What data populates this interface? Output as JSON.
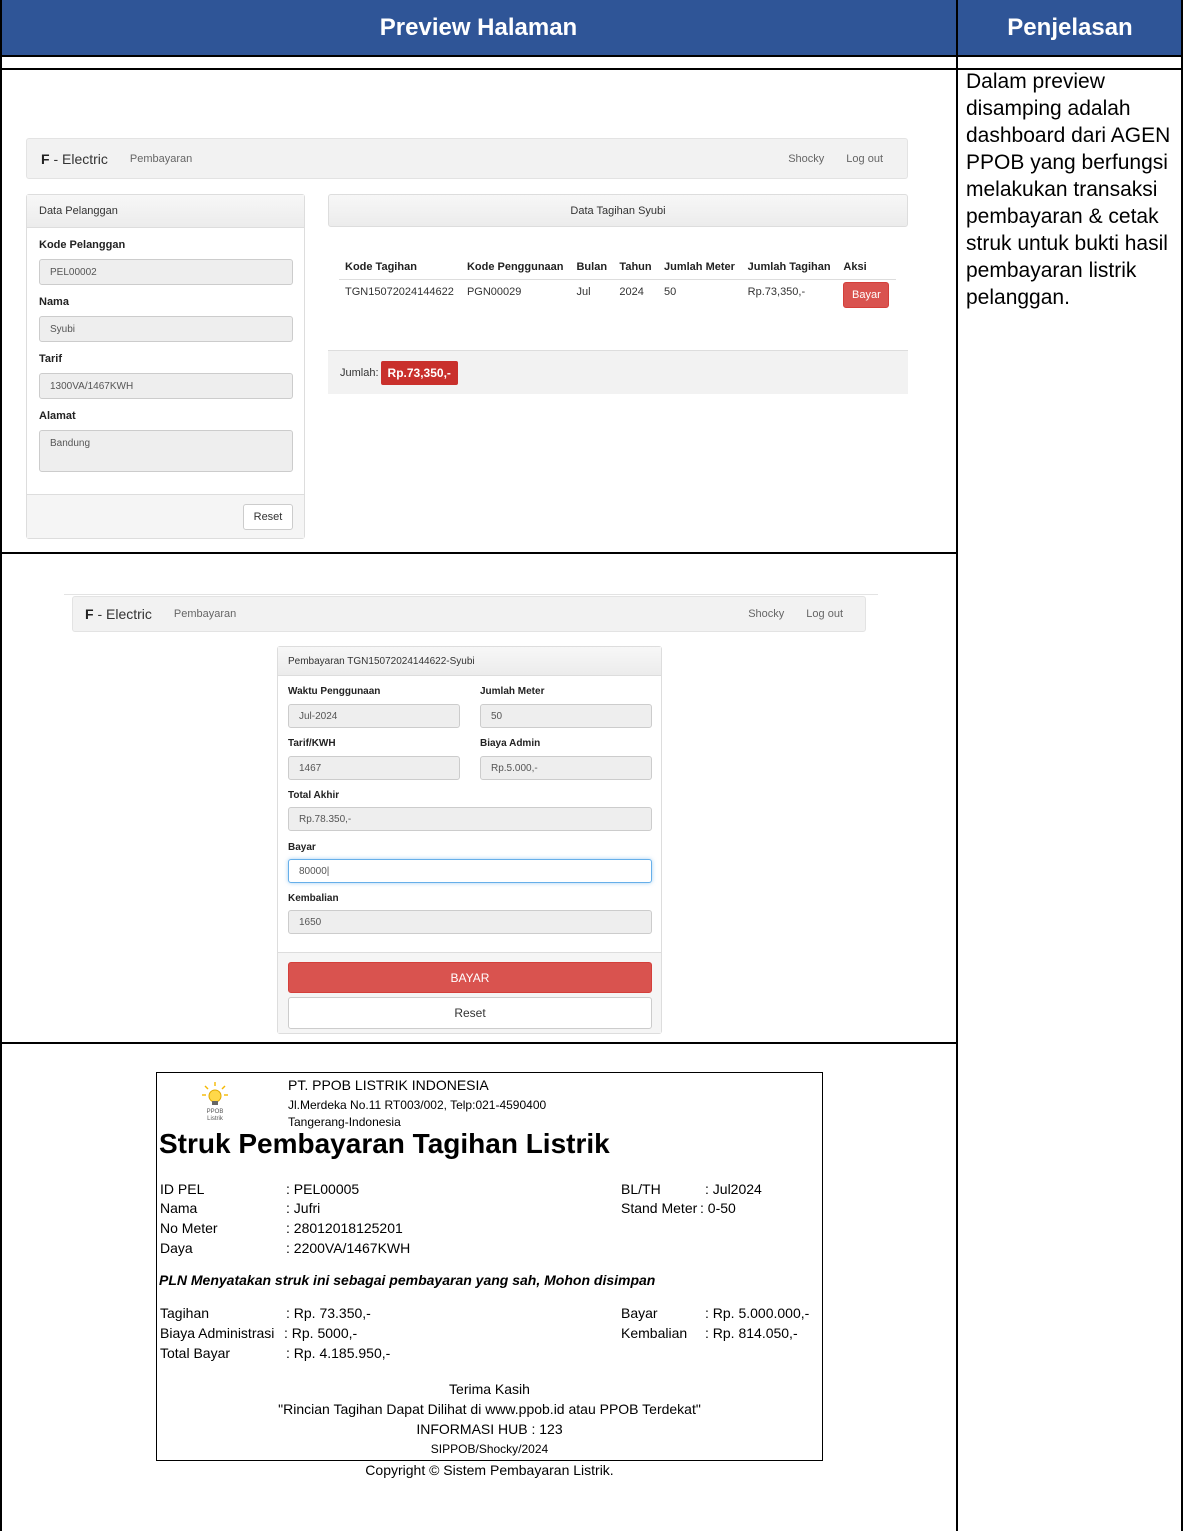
{
  "headers": {
    "preview": "Preview Halaman",
    "explanation": "Penjelasan"
  },
  "explanation": "Dalam preview disamping adalah dashboard dari AGEN PPOB yang berfungsi melakukan transaksi pembayaran & cetak struk untuk bukti hasil pembayaran listrik pelanggan.",
  "dashboard": {
    "brand_bold": "F",
    "brand_rest": " - Electric",
    "nav_link": "Pembayaran",
    "user": "Shocky",
    "logout": "Log out",
    "customer_panel": {
      "title": "Data Pelanggan",
      "fields": [
        {
          "label": "Kode Pelanggan",
          "value": "PEL00002"
        },
        {
          "label": "Nama",
          "value": "Syubi"
        },
        {
          "label": "Tarif",
          "value": "1300VA/1467KWH"
        },
        {
          "label": "Alamat",
          "value": "Bandung"
        }
      ],
      "reset": "Reset"
    },
    "bill_panel": {
      "title": "Data Tagihan Syubi",
      "columns": [
        "Kode Tagihan",
        "Kode Penggunaan",
        "Bulan",
        "Tahun",
        "Jumlah Meter",
        "Jumlah Tagihan",
        "Aksi"
      ],
      "row": {
        "kode_tagihan": "TGN15072024144622",
        "kode_penggunaan": "PGN00029",
        "bulan": "Jul",
        "tahun": "2024",
        "jumlah_meter": "50",
        "jumlah_tagihan": "Rp.73,350,-",
        "aksi": "Bayar"
      },
      "total_label": "Jumlah:",
      "total_value": "Rp.73,350,-"
    }
  },
  "payment": {
    "brand_bold": "F",
    "brand_rest": " - Electric",
    "nav_link": "Pembayaran",
    "user": "Shocky",
    "logout": "Log out",
    "title": "Pembayaran TGN15072024144622-Syubi",
    "waktu_label": "Waktu Penggunaan",
    "waktu_value": "Jul-2024",
    "meter_label": "Jumlah Meter",
    "meter_value": "50",
    "tarif_label": "Tarif/KWH",
    "tarif_value": "1467",
    "admin_label": "Biaya Admin",
    "admin_value": "Rp.5.000,-",
    "total_label": "Total Akhir",
    "total_value": "Rp.78.350,-",
    "bayar_label": "Bayar",
    "bayar_value": "80000|",
    "kembalian_label": "Kembalian",
    "kembalian_value": "1650",
    "submit": "BAYAR",
    "reset": "Reset"
  },
  "receipt": {
    "company": "PT. PPOB LISTRIK INDONESIA",
    "address": "Jl.Merdeka No.11 RT003/002, Telp:021-4590400",
    "city": "Tangerang-Indonesia",
    "logo_text": "PPOB Listrik",
    "title": "Struk Pembayaran Tagihan Listrik",
    "left": [
      {
        "label": "ID PEL",
        "value": ": PEL00005"
      },
      {
        "label": "Nama",
        "value": ": Jufri"
      },
      {
        "label": "No Meter",
        "value": ": 28012018125201"
      },
      {
        "label": "Daya",
        "value": ": 2200VA/1467KWH"
      }
    ],
    "right": [
      {
        "label": "BL/TH",
        "value": ": Jul2024"
      },
      {
        "label": "Stand Meter",
        "value": ": 0-50"
      }
    ],
    "notice": "PLN Menyatakan struk ini sebagai pembayaran yang sah, Mohon disimpan",
    "bill_left": [
      {
        "label": "Tagihan",
        "value": ": Rp. 73.350,-"
      },
      {
        "label": "Biaya Administrasi",
        "value": ": Rp. 5000,-"
      },
      {
        "label": "Total Bayar",
        "value": ": Rp. 4.185.950,-"
      }
    ],
    "bill_right": [
      {
        "label": "Bayar",
        "value": ": Rp. 5.000.000,-"
      },
      {
        "label": "Kembalian",
        "value": ": Rp. 814.050,-"
      }
    ],
    "thanks": "Terima Kasih",
    "info": "\"Rincian Tagihan Dapat Dilihat di www.ppob.id atau PPOB Terdekat\"",
    "hub": "INFORMASI HUB : 123",
    "footer_code": "SIPPOB/Shocky/2024",
    "copyright": "Copyright © Sistem Pembayaran Listrik."
  }
}
